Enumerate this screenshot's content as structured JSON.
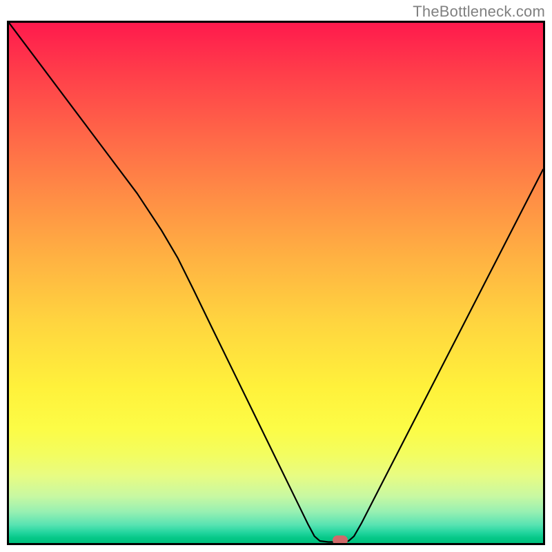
{
  "watermark": "TheBottleneck.com",
  "chart_data": {
    "type": "line",
    "title": "",
    "xlabel": "",
    "ylabel": "",
    "xlim": [
      0,
      100
    ],
    "ylim": [
      0,
      100
    ],
    "grid": false,
    "curve_points": [
      {
        "x": 0.0,
        "y": 100.0
      },
      {
        "x": 6.0,
        "y": 91.8
      },
      {
        "x": 12.0,
        "y": 83.6
      },
      {
        "x": 18.0,
        "y": 75.4
      },
      {
        "x": 24.0,
        "y": 67.2
      },
      {
        "x": 28.5,
        "y": 60.2
      },
      {
        "x": 31.6,
        "y": 54.8
      },
      {
        "x": 34.5,
        "y": 48.8
      },
      {
        "x": 38.0,
        "y": 41.4
      },
      {
        "x": 42.0,
        "y": 33.0
      },
      {
        "x": 46.0,
        "y": 24.6
      },
      {
        "x": 50.0,
        "y": 16.2
      },
      {
        "x": 54.0,
        "y": 7.8
      },
      {
        "x": 56.0,
        "y": 3.6
      },
      {
        "x": 57.2,
        "y": 1.3
      },
      {
        "x": 58.2,
        "y": 0.4
      },
      {
        "x": 59.8,
        "y": 0.2
      },
      {
        "x": 61.4,
        "y": 0.2
      },
      {
        "x": 62.6,
        "y": 0.2
      },
      {
        "x": 63.6,
        "y": 0.4
      },
      {
        "x": 64.6,
        "y": 1.3
      },
      {
        "x": 66.0,
        "y": 3.8
      },
      {
        "x": 70.0,
        "y": 11.8
      },
      {
        "x": 75.0,
        "y": 21.8
      },
      {
        "x": 80.0,
        "y": 31.8
      },
      {
        "x": 85.0,
        "y": 41.8
      },
      {
        "x": 90.0,
        "y": 51.8
      },
      {
        "x": 95.0,
        "y": 61.8
      },
      {
        "x": 100.0,
        "y": 71.8
      }
    ],
    "marker": {
      "x": 62.0,
      "y": 0.5,
      "color": "#d06a6a"
    }
  }
}
